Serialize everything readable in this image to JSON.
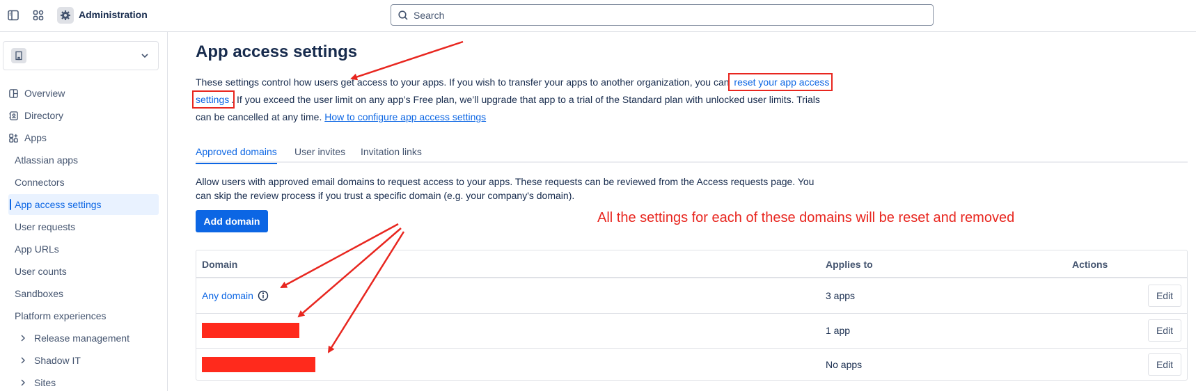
{
  "header": {
    "app_title": "Administration",
    "search_placeholder": "Search"
  },
  "sidebar": {
    "items": [
      {
        "label": "Overview",
        "icon": "overview-icon"
      },
      {
        "label": "Directory",
        "icon": "directory-icon"
      },
      {
        "label": "Apps",
        "icon": "apps-icon"
      },
      {
        "label": "Atlassian apps"
      },
      {
        "label": "Connectors"
      },
      {
        "label": "App access settings",
        "active": true
      },
      {
        "label": "User requests"
      },
      {
        "label": "App URLs"
      },
      {
        "label": "User counts"
      },
      {
        "label": "Sandboxes"
      },
      {
        "label": "Platform experiences"
      },
      {
        "label": "Release management"
      },
      {
        "label": "Shadow IT"
      },
      {
        "label": "Sites"
      }
    ]
  },
  "main": {
    "title": "App access settings",
    "desc_part1": "These settings control how users get access to your apps. If you wish to transfer your apps to another organization, you can",
    "desc_link": "reset your app access settings",
    "desc_part2": ". If you exceed the user limit on any app’s Free plan, we’ll upgrade that app to a trial of the Standard plan with unlocked user limits. Trials can be cancelled at any time.",
    "desc_link2": "How to configure app access settings",
    "tabs": [
      {
        "label": "Approved domains",
        "active": true
      },
      {
        "label": "User invites"
      },
      {
        "label": "Invitation links"
      }
    ],
    "tab_description": "Allow users with approved email domains to request access to your apps. These requests can be reviewed from the Access requests page. You can skip the review process if you trust a specific domain (e.g. your company's domain).",
    "add_button": "Add domain",
    "table": {
      "headers": [
        "Domain",
        "Applies to",
        "Actions"
      ],
      "rows": [
        {
          "domain": "Any domain",
          "applies_to": "3 apps",
          "action": "Edit"
        },
        {
          "domain": "",
          "applies_to": "1 app",
          "action": "Edit",
          "redacted": true
        },
        {
          "domain": "",
          "applies_to": "No apps",
          "action": "Edit",
          "redacted": true
        }
      ]
    }
  },
  "annotation": {
    "text": "All the settings for each of these domains will be reset and removed",
    "color": "#E8261F"
  },
  "colors": {
    "accent": "#0C66E4",
    "annotation_red": "#E8261F",
    "redaction": "#FF2A1C"
  }
}
